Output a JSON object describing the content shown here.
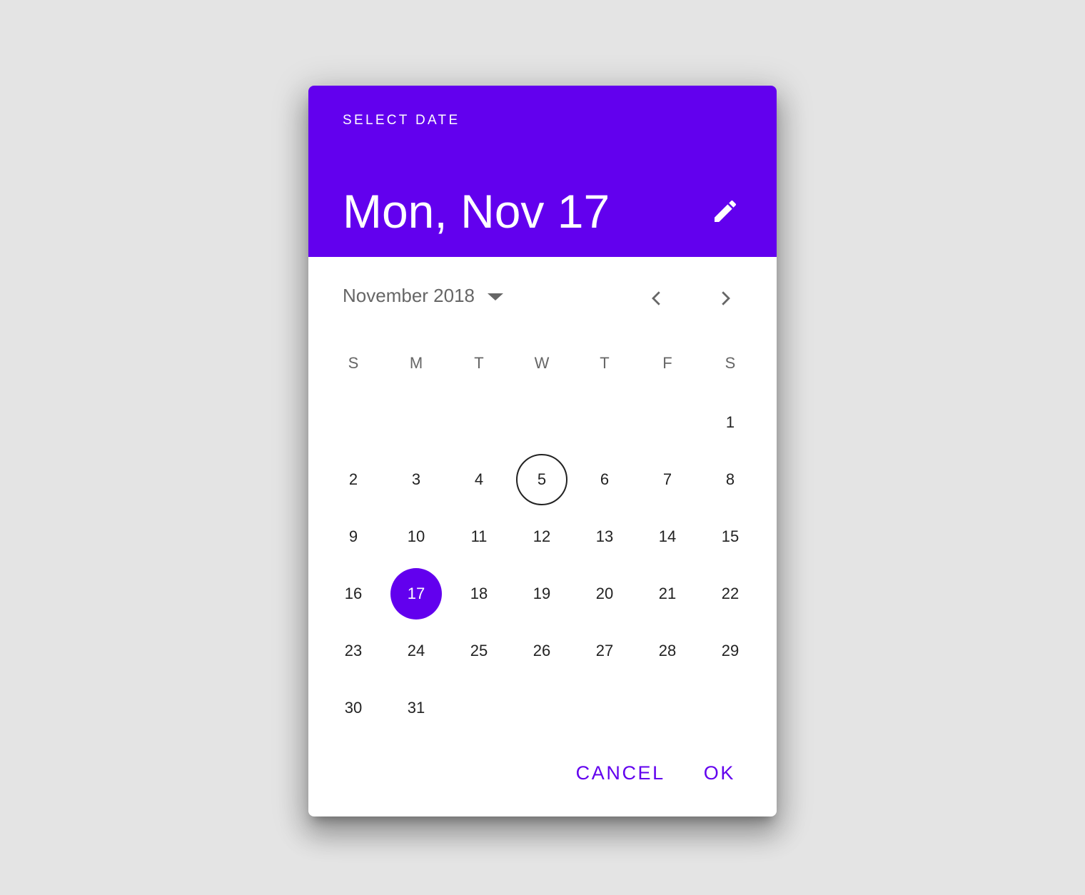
{
  "header": {
    "label": "SELECT DATE",
    "selected_date": "Mon, Nov 17",
    "edit_icon": "pencil-icon"
  },
  "calendar": {
    "month_label": "November 2018",
    "dropdown_icon": "caret-down-icon",
    "prev_icon": "chevron-left-icon",
    "next_icon": "chevron-right-icon",
    "weekdays": [
      "S",
      "M",
      "T",
      "W",
      "T",
      "F",
      "S"
    ],
    "first_weekday_index": 6,
    "days": [
      "1",
      "2",
      "3",
      "4",
      "5",
      "6",
      "7",
      "8",
      "9",
      "10",
      "11",
      "12",
      "13",
      "14",
      "15",
      "16",
      "17",
      "18",
      "19",
      "20",
      "21",
      "22",
      "23",
      "24",
      "25",
      "26",
      "27",
      "28",
      "29",
      "30",
      "31"
    ],
    "today": "5",
    "selected": "17"
  },
  "actions": {
    "cancel_label": "CANCEL",
    "ok_label": "OK"
  },
  "colors": {
    "accent": "#6200ee",
    "background": "#e4e4e4"
  }
}
